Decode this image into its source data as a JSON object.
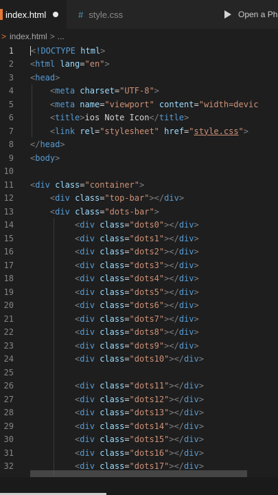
{
  "tabs": [
    {
      "label": "index.html",
      "active": true,
      "unsaved": true
    },
    {
      "label": "style.css",
      "active": false,
      "icon": "#"
    }
  ],
  "run_label": "Open a Ph",
  "breadcrumb": {
    "file": "index.html",
    "separator": ">",
    "tail": "..."
  },
  "lines": [
    {
      "num": "1",
      "html": "<span class='cursor'></span><span class='p'>&lt;</span><span class='t'>!DOCTYPE</span> <span class='a'>html</span><span class='p'>&gt;</span>"
    },
    {
      "num": "2",
      "html": "<span class='p'>&lt;</span><span class='t'>html</span> <span class='a'>lang</span>=<span class='s'>\"en\"</span><span class='p'>&gt;</span>"
    },
    {
      "num": "3",
      "html": "<span class='p'>&lt;</span><span class='t'>head</span><span class='p'>&gt;</span>"
    },
    {
      "num": "4",
      "html": "    <span class='p'>&lt;</span><span class='t'>meta</span> <span class='a'>charset</span>=<span class='s'>\"UTF-8\"</span><span class='p'>&gt;</span>"
    },
    {
      "num": "5",
      "html": "    <span class='p'>&lt;</span><span class='t'>meta</span> <span class='a'>name</span>=<span class='s'>\"viewport\"</span> <span class='a'>content</span>=<span class='s'>\"width=devic</span>"
    },
    {
      "num": "6",
      "html": "    <span class='p'>&lt;</span><span class='t'>title</span><span class='p'>&gt;</span><span class='txt'>ios Note Icon</span><span class='p'>&lt;/</span><span class='t'>title</span><span class='p'>&gt;</span>"
    },
    {
      "num": "7",
      "html": "    <span class='p'>&lt;</span><span class='t'>link</span> <span class='a'>rel</span>=<span class='s'>\"stylesheet\"</span> <span class='a'>href</span>=<span class='s'>\"<span class='u'>style.css</span>\"</span><span class='p'>&gt;</span>"
    },
    {
      "num": "8",
      "html": "<span class='p'>&lt;/</span><span class='t'>head</span><span class='p'>&gt;</span>"
    },
    {
      "num": "9",
      "html": "<span class='p'>&lt;</span><span class='t'>body</span><span class='p'>&gt;</span>"
    },
    {
      "num": "10",
      "html": ""
    },
    {
      "num": "11",
      "html": "<span class='p'>&lt;</span><span class='t'>div</span> <span class='a'>class</span>=<span class='s'>\"container\"</span><span class='p'>&gt;</span>"
    },
    {
      "num": "12",
      "html": "    <span class='p'>&lt;</span><span class='t'>div</span> <span class='a'>class</span>=<span class='s'>\"top-bar\"</span><span class='p'>&gt;&lt;/</span><span class='t'>div</span><span class='p'>&gt;</span>"
    },
    {
      "num": "13",
      "html": "    <span class='p'>&lt;</span><span class='t'>div</span> <span class='a'>class</span>=<span class='s'>\"dots-bar\"</span><span class='p'>&gt;</span>"
    },
    {
      "num": "14",
      "html": "         <span class='p'>&lt;</span><span class='t'>div</span> <span class='a'>class</span>=<span class='s'>\"dots0\"</span><span class='p'>&gt;&lt;/</span><span class='t'>div</span><span class='p'>&gt;</span>"
    },
    {
      "num": "15",
      "html": "         <span class='p'>&lt;</span><span class='t'>div</span> <span class='a'>class</span>=<span class='s'>\"dots1\"</span><span class='p'>&gt;&lt;/</span><span class='t'>div</span><span class='p'>&gt;</span>"
    },
    {
      "num": "16",
      "html": "         <span class='p'>&lt;</span><span class='t'>div</span> <span class='a'>class</span>=<span class='s'>\"dots2\"</span><span class='p'>&gt;&lt;/</span><span class='t'>div</span><span class='p'>&gt;</span>"
    },
    {
      "num": "17",
      "html": "         <span class='p'>&lt;</span><span class='t'>div</span> <span class='a'>class</span>=<span class='s'>\"dots3\"</span><span class='p'>&gt;&lt;/</span><span class='t'>div</span><span class='p'>&gt;</span>"
    },
    {
      "num": "18",
      "html": "         <span class='p'>&lt;</span><span class='t'>div</span> <span class='a'>class</span>=<span class='s'>\"dots4\"</span><span class='p'>&gt;&lt;/</span><span class='t'>div</span><span class='p'>&gt;</span>"
    },
    {
      "num": "19",
      "html": "         <span class='p'>&lt;</span><span class='t'>div</span> <span class='a'>class</span>=<span class='s'>\"dots5\"</span><span class='p'>&gt;&lt;/</span><span class='t'>div</span><span class='p'>&gt;</span>"
    },
    {
      "num": "20",
      "html": "         <span class='p'>&lt;</span><span class='t'>div</span> <span class='a'>class</span>=<span class='s'>\"dots6\"</span><span class='p'>&gt;&lt;/</span><span class='t'>div</span><span class='p'>&gt;</span>"
    },
    {
      "num": "21",
      "html": "         <span class='p'>&lt;</span><span class='t'>div</span> <span class='a'>class</span>=<span class='s'>\"dots7\"</span><span class='p'>&gt;&lt;/</span><span class='t'>div</span><span class='p'>&gt;</span>"
    },
    {
      "num": "22",
      "html": "         <span class='p'>&lt;</span><span class='t'>div</span> <span class='a'>class</span>=<span class='s'>\"dots8\"</span><span class='p'>&gt;&lt;/</span><span class='t'>div</span><span class='p'>&gt;</span>"
    },
    {
      "num": "23",
      "html": "         <span class='p'>&lt;</span><span class='t'>div</span> <span class='a'>class</span>=<span class='s'>\"dots9\"</span><span class='p'>&gt;&lt;/</span><span class='t'>div</span><span class='p'>&gt;</span>"
    },
    {
      "num": "24",
      "html": "         <span class='p'>&lt;</span><span class='t'>div</span> <span class='a'>class</span>=<span class='s'>\"dots10\"</span><span class='p'>&gt;&lt;/</span><span class='t'>div</span><span class='p'>&gt;</span>"
    },
    {
      "num": "25",
      "html": ""
    },
    {
      "num": "26",
      "html": "         <span class='p'>&lt;</span><span class='t'>div</span> <span class='a'>class</span>=<span class='s'>\"dots11\"</span><span class='p'>&gt;&lt;/</span><span class='t'>div</span><span class='p'>&gt;</span>"
    },
    {
      "num": "27",
      "html": "         <span class='p'>&lt;</span><span class='t'>div</span> <span class='a'>class</span>=<span class='s'>\"dots12\"</span><span class='p'>&gt;&lt;/</span><span class='t'>div</span><span class='p'>&gt;</span>"
    },
    {
      "num": "28",
      "html": "         <span class='p'>&lt;</span><span class='t'>div</span> <span class='a'>class</span>=<span class='s'>\"dots13\"</span><span class='p'>&gt;&lt;/</span><span class='t'>div</span><span class='p'>&gt;</span>"
    },
    {
      "num": "29",
      "html": "         <span class='p'>&lt;</span><span class='t'>div</span> <span class='a'>class</span>=<span class='s'>\"dots14\"</span><span class='p'>&gt;&lt;/</span><span class='t'>div</span><span class='p'>&gt;</span>"
    },
    {
      "num": "30",
      "html": "         <span class='p'>&lt;</span><span class='t'>div</span> <span class='a'>class</span>=<span class='s'>\"dots15\"</span><span class='p'>&gt;&lt;/</span><span class='t'>div</span><span class='p'>&gt;</span>"
    },
    {
      "num": "31",
      "html": "         <span class='p'>&lt;</span><span class='t'>div</span> <span class='a'>class</span>=<span class='s'>\"dots16\"</span><span class='p'>&gt;&lt;/</span><span class='t'>div</span><span class='p'>&gt;</span>"
    },
    {
      "num": "32",
      "html": "         <span class='p'>&lt;</span><span class='t'>div</span> <span class='a'>class</span>=<span class='s'>\"dots17\"</span><span class='p'>&gt;&lt;/</span><span class='t'>div</span><span class='p'>&gt;</span>"
    }
  ],
  "colors": {
    "tag": "#569cd6",
    "attribute": "#9cdcfe",
    "string": "#ce9178",
    "punctuation": "#808080",
    "html_icon": "#e37933",
    "css_icon": "#519aba"
  }
}
